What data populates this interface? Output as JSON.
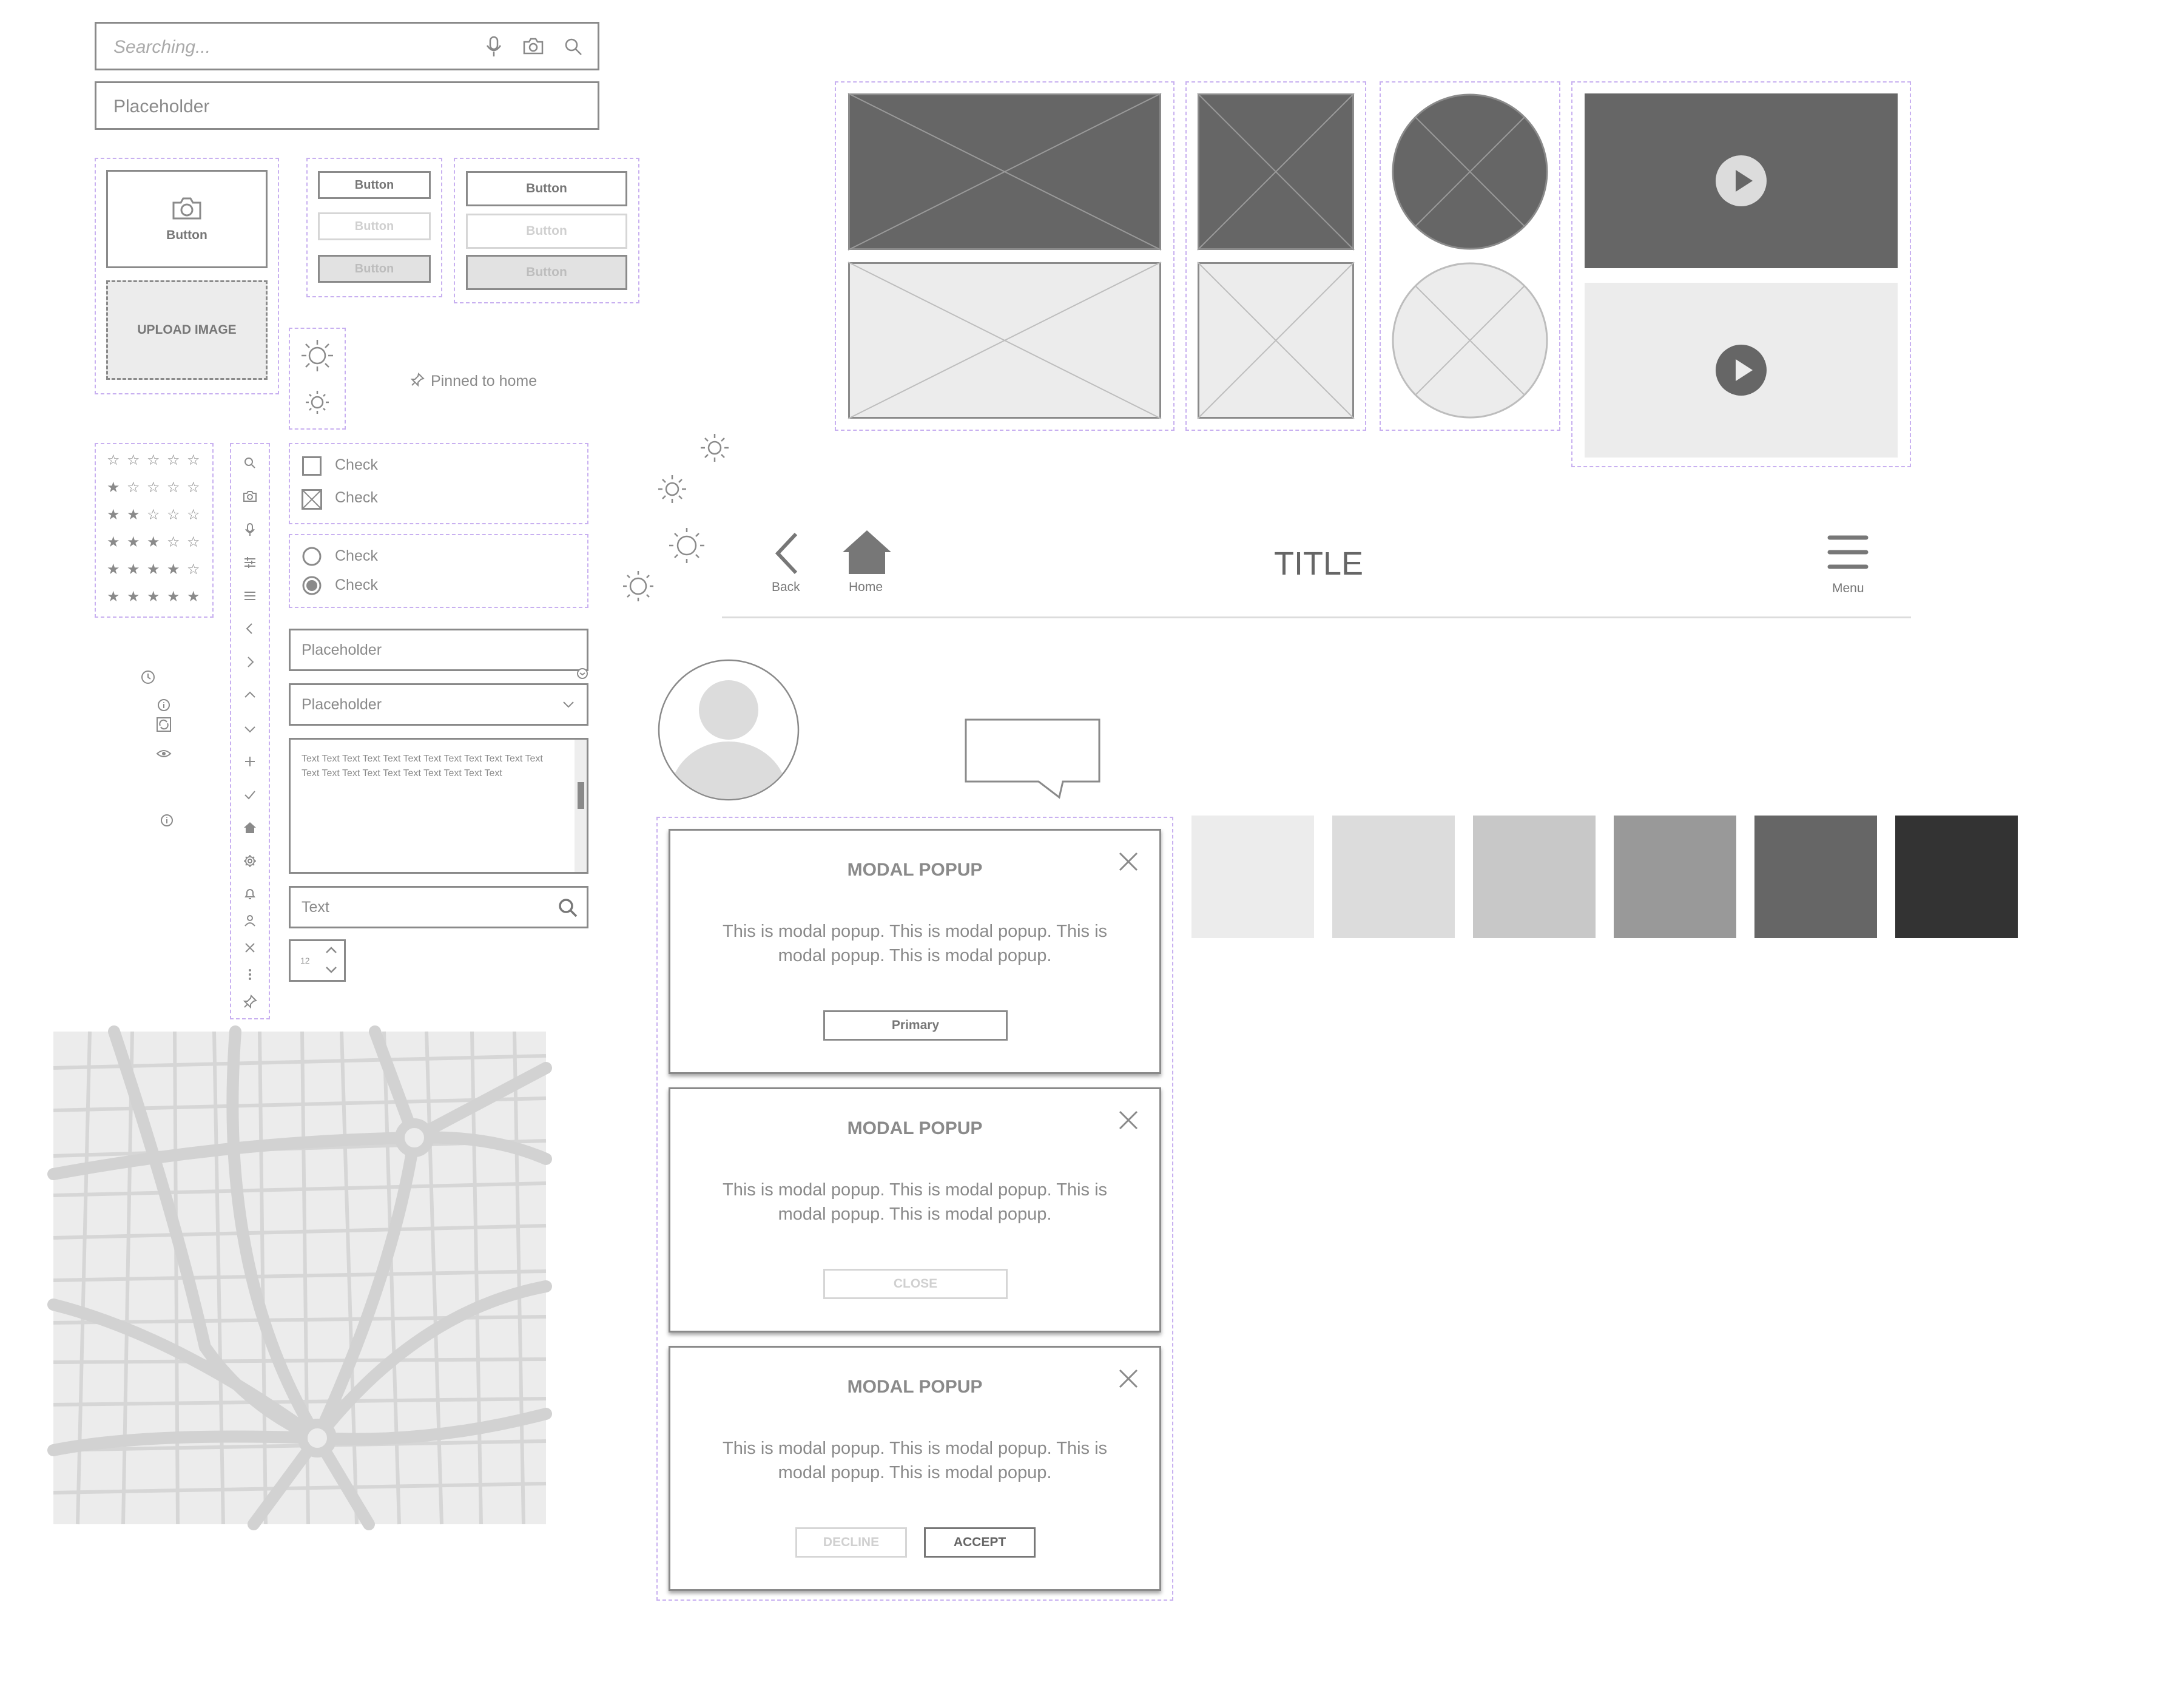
{
  "search": {
    "placeholder": "Searching..."
  },
  "input_top": {
    "placeholder": "Placeholder"
  },
  "buttons": {
    "camera_button": "Button",
    "upload_image": "UPLOAD IMAGE",
    "small": [
      "Button",
      "Button",
      "Button"
    ],
    "medium": [
      "Button",
      "Button",
      "Button"
    ]
  },
  "pinned": {
    "label": "Pinned to home"
  },
  "checkboxes": [
    "Check",
    "Check"
  ],
  "radios": [
    "Check",
    "Check"
  ],
  "form": {
    "text_input_placeholder": "Placeholder",
    "select_value": "Placeholder",
    "textarea_text": "Text Text Text Text Text Text Text Text Text Text Text Text Text Text Text Text Text Text Text Text Text Text",
    "search_text": "Text",
    "stepper_value": "12"
  },
  "navbar": {
    "back": "Back",
    "home": "Home",
    "title": "TITLE",
    "menu": "Menu"
  },
  "modals": [
    {
      "title": "MODAL POPUP",
      "body": "This is modal popup. This is modal popup. This is modal popup. This is modal popup.",
      "buttons": [
        "Primary"
      ]
    },
    {
      "title": "MODAL POPUP",
      "body": "This is modal popup. This is modal popup. This is modal popup. This is modal popup.",
      "buttons": [
        "CLOSE"
      ]
    },
    {
      "title": "MODAL POPUP",
      "body": "This is modal popup. This is modal popup. This is modal popup. This is modal popup.",
      "buttons": [
        "DECLINE",
        "ACCEPT"
      ]
    }
  ],
  "ratings": [
    0,
    1,
    2,
    3,
    4,
    5
  ],
  "swatches": [
    "#ececec",
    "#dcdcdc",
    "#c8c8c8",
    "#999999",
    "#666666",
    "#333333"
  ],
  "colors": {
    "wire": "#8a8a8a",
    "dashed": "#c8b0f0",
    "dark_fill": "#666666",
    "light_fill": "#ececec",
    "map_bg": "#ececec",
    "map_road": "#d4d4d4"
  },
  "icon_column": [
    "search-icon",
    "camera-icon",
    "microphone-icon",
    "sliders-icon",
    "menu-icon",
    "chevron-left-icon",
    "chevron-right-icon",
    "chevron-up-icon",
    "chevron-down-icon",
    "plus-icon",
    "check-icon",
    "home-icon",
    "gear-icon",
    "bell-icon",
    "user-icon",
    "close-icon",
    "more-vertical-icon",
    "pin-icon"
  ]
}
